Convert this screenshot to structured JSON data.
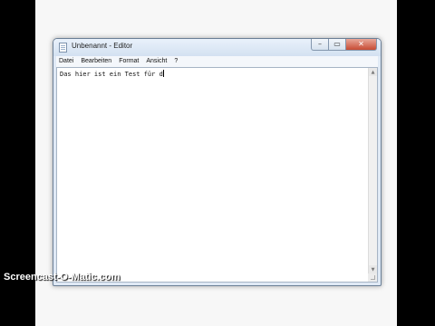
{
  "window": {
    "title": "Unbenannt - Editor",
    "icon": "notepad-icon",
    "controls": {
      "minimize": "minimize-icon",
      "maximize": "maximize-icon",
      "close": "close-icon"
    }
  },
  "menubar": {
    "items": [
      {
        "label": "Datei"
      },
      {
        "label": "Bearbeiten"
      },
      {
        "label": "Format"
      },
      {
        "label": "Ansicht"
      },
      {
        "label": "?"
      }
    ]
  },
  "editor": {
    "content": "Das hier ist ein Test für d"
  },
  "watermark": "Screencast-O-Matic.com",
  "colors": {
    "background": "#000000",
    "desktop": "#f7f7f7",
    "window_frame": "#dfe9f5",
    "close_button": "#c74b34"
  }
}
